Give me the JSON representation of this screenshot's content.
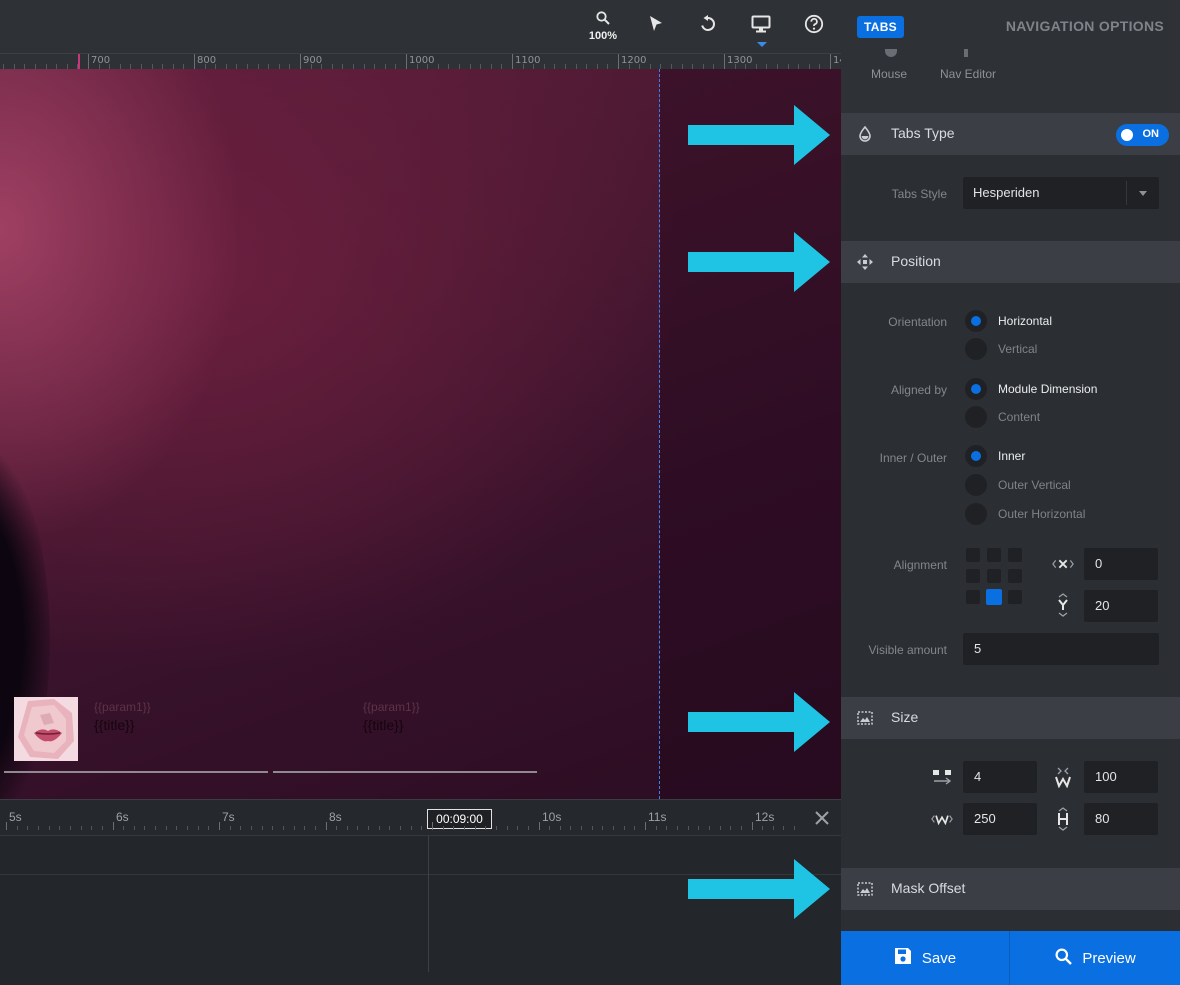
{
  "toolbar": {
    "zoom_label": "100%",
    "icons": [
      "search-icon",
      "cursor-icon",
      "undo-icon",
      "desktop-icon",
      "help-icon"
    ]
  },
  "ruler": {
    "labels": [
      "700",
      "800",
      "900",
      "1000",
      "1100",
      "1200",
      "1300",
      "14"
    ]
  },
  "canvas": {
    "tabs": [
      {
        "param": "{{param1}}",
        "title": "{{title}}"
      },
      {
        "param": "{{param1}}",
        "title": "{{title}}"
      }
    ]
  },
  "timeline": {
    "labels": [
      "5s",
      "6s",
      "7s",
      "8s",
      "10s",
      "11s",
      "12s"
    ],
    "current_time": "00:09:00"
  },
  "panel": {
    "badge": "TABS",
    "title": "NAVIGATION OPTIONS",
    "subtabs": [
      "Mouse",
      "Nav Editor"
    ],
    "tabs_type": {
      "title": "Tabs Type",
      "toggle": "ON",
      "style_label": "Tabs Style",
      "style_value": "Hesperiden"
    },
    "position": {
      "title": "Position",
      "orientation_label": "Orientation",
      "orientation_options": [
        "Horizontal",
        "Vertical"
      ],
      "aligned_label": "Aligned by",
      "aligned_options": [
        "Module Dimension",
        "Content"
      ],
      "inner_outer_label": "Inner / Outer",
      "inner_outer_options": [
        "Inner",
        "Outer Vertical",
        "Outer Horizontal"
      ],
      "alignment_label": "Alignment",
      "x_value": "0",
      "y_value": "20",
      "visible_label": "Visible amount",
      "visible_value": "5"
    },
    "size": {
      "title": "Size",
      "spacing": "4",
      "min_width": "100",
      "width": "250",
      "height": "80"
    },
    "mask": {
      "title": "Mask Offset"
    },
    "footer": {
      "save": "Save",
      "preview": "Preview"
    }
  },
  "colors": {
    "accent": "#0a6fe0",
    "arrow": "#1fc4e4",
    "panel_bg": "#2b2e32",
    "section_bg": "#3b3f45"
  }
}
